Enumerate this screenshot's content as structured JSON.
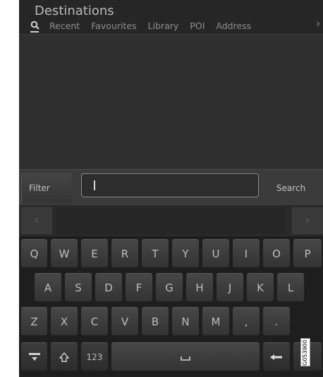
{
  "header": {
    "title": "Destinations",
    "tabs": [
      "Recent",
      "Favourites",
      "Library",
      "POI",
      "Address"
    ],
    "more_icon": "chevron-right-icon"
  },
  "search_bar": {
    "filter_label": "Filter",
    "input_value": "",
    "search_label": "Search"
  },
  "suggestions": {
    "prev_icon": "chevron-left-icon",
    "next_icon": "chevron-right-icon"
  },
  "keyboard": {
    "row1": [
      "Q",
      "W",
      "E",
      "R",
      "T",
      "Y",
      "U",
      "I",
      "O",
      "P"
    ],
    "row2": [
      "A",
      "S",
      "D",
      "F",
      "G",
      "H",
      "J",
      "K",
      "L"
    ],
    "row3": [
      "Z",
      "X",
      "C",
      "V",
      "B",
      "N",
      "M",
      ",",
      "."
    ],
    "numbers_label": "123",
    "hide_icon": "keyboard-hide-icon",
    "shift_icon": "shift-icon",
    "space_icon": "space-icon",
    "backspace_icon": "backspace-icon"
  },
  "watermark": "G053900"
}
